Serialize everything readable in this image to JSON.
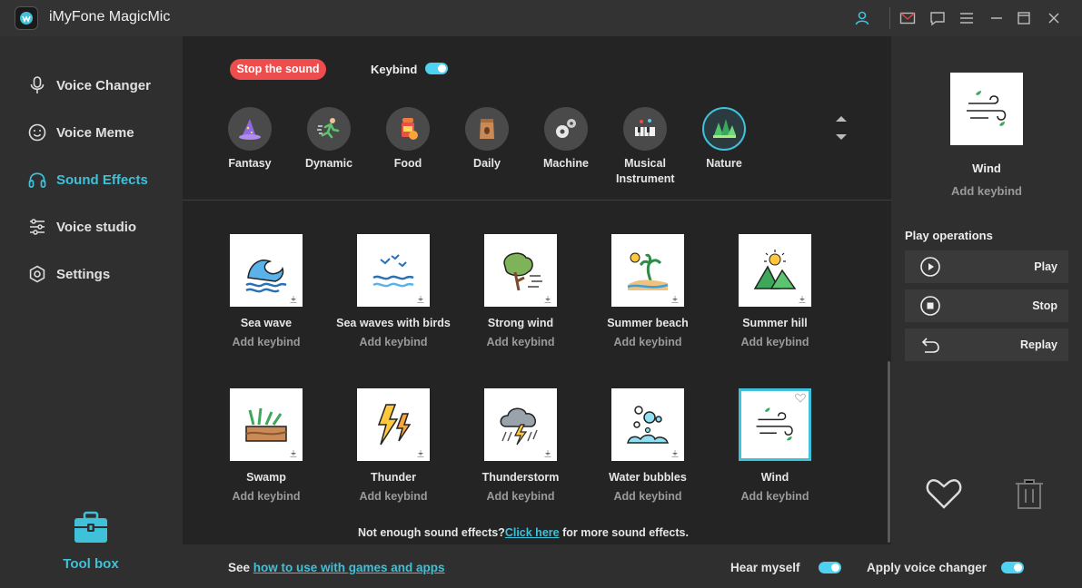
{
  "app": {
    "title": "iMyFone MagicMic"
  },
  "sidebar": {
    "items": [
      {
        "label": "Voice Changer",
        "icon": "microphone-icon",
        "active": false
      },
      {
        "label": "Voice Meme",
        "icon": "smiley-icon",
        "active": false
      },
      {
        "label": "Sound Effects",
        "icon": "headphones-icon",
        "active": true
      },
      {
        "label": "Voice studio",
        "icon": "sliders-icon",
        "active": false
      },
      {
        "label": "Settings",
        "icon": "gear-icon",
        "active": false
      }
    ],
    "toolbox_label": "Tool box"
  },
  "top_controls": {
    "stop_label": "Stop the sound",
    "keybind_label": "Keybind",
    "keybind_on": true
  },
  "categories": [
    {
      "label": "Fantasy",
      "icon": "wizard-hat-icon"
    },
    {
      "label": "Dynamic",
      "icon": "runner-icon"
    },
    {
      "label": "Food",
      "icon": "food-icon"
    },
    {
      "label": "Daily",
      "icon": "coffee-bag-icon"
    },
    {
      "label": "Machine",
      "icon": "gears-icon"
    },
    {
      "label": "Musical Instrument",
      "icon": "keyboard-icon"
    },
    {
      "label": "Nature",
      "icon": "trees-icon",
      "active": true
    }
  ],
  "sounds": [
    {
      "name": "Sea wave",
      "keybind": "Add keybind",
      "icon": "wave-icon"
    },
    {
      "name": "Sea waves with birds",
      "keybind": "Add keybind",
      "icon": "birds-waves-icon"
    },
    {
      "name": "Strong wind",
      "keybind": "Add keybind",
      "icon": "windy-tree-icon"
    },
    {
      "name": "Summer beach",
      "keybind": "Add keybind",
      "icon": "palm-beach-icon"
    },
    {
      "name": "Summer hill",
      "keybind": "Add keybind",
      "icon": "hill-sun-icon"
    },
    {
      "name": "Swamp",
      "keybind": "Add keybind",
      "icon": "swamp-icon"
    },
    {
      "name": "Thunder",
      "keybind": "Add keybind",
      "icon": "lightning-icon"
    },
    {
      "name": "Thunderstorm",
      "keybind": "Add keybind",
      "icon": "storm-cloud-icon"
    },
    {
      "name": "Water bubbles",
      "keybind": "Add keybind",
      "icon": "bubbles-icon"
    },
    {
      "name": "Wind",
      "keybind": "Add keybind",
      "icon": "wind-icon",
      "selected": true
    }
  ],
  "more_effects": {
    "prefix": "Not enough sound effects?",
    "link": "Click here",
    "suffix": " for more sound effects."
  },
  "bottom": {
    "see_prefix": "See ",
    "see_link": "how to use with games and apps",
    "hear_myself": "Hear myself",
    "hear_myself_on": true,
    "apply_voice_changer": "Apply voice changer",
    "apply_voice_changer_on": true
  },
  "right_panel": {
    "selected_name": "Wind",
    "selected_keybind": "Add keybind",
    "ops_title": "Play operations",
    "play": "Play",
    "stop": "Stop",
    "replay": "Replay"
  },
  "colors": {
    "accent": "#3ec1d9",
    "stop": "#ee4d4d"
  }
}
